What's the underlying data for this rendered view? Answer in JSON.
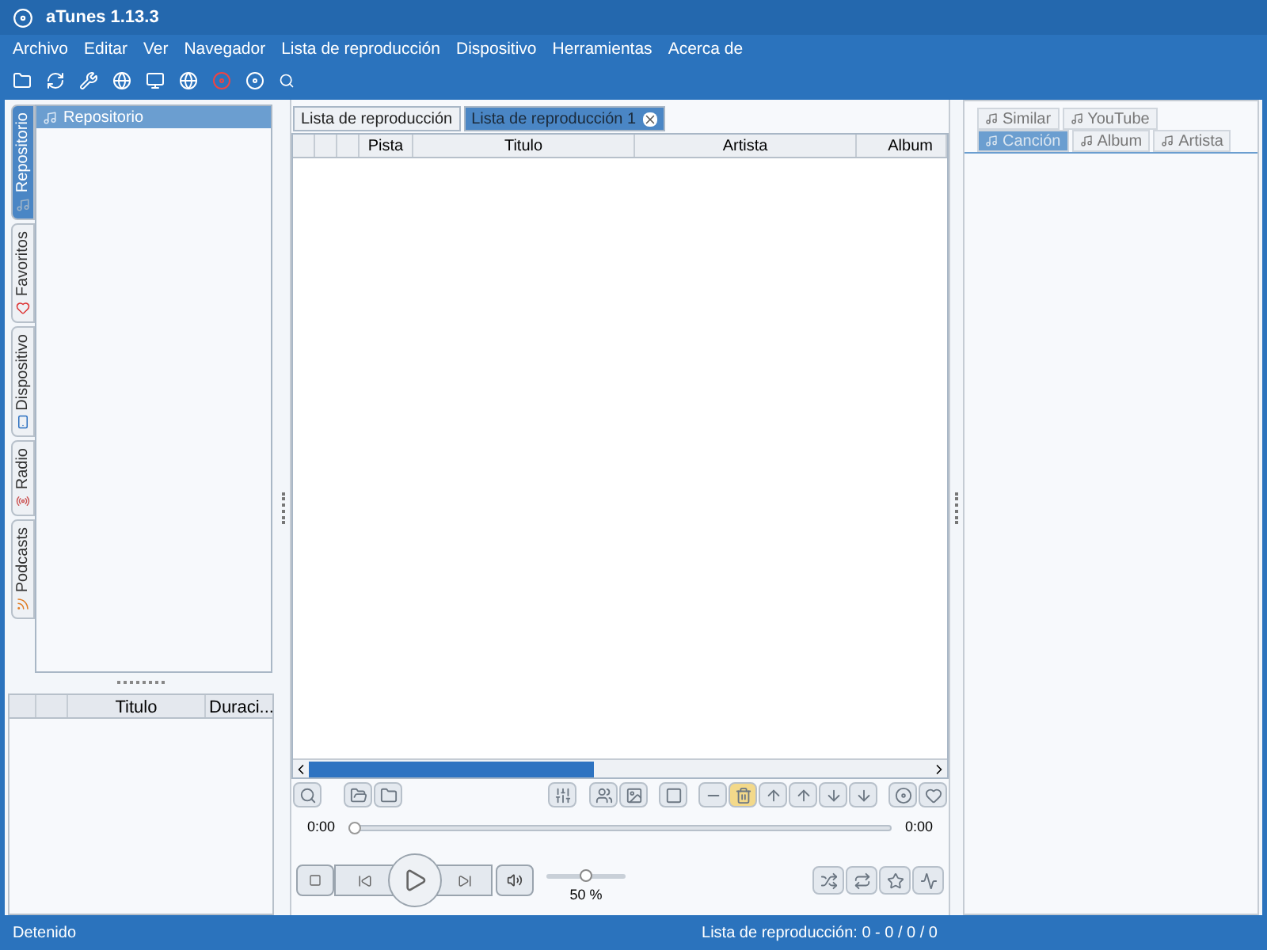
{
  "window": {
    "title": "aTunes 1.13.3"
  },
  "menu": [
    "Archivo",
    "Editar",
    "Ver",
    "Navegador",
    "Lista de reproducción",
    "Dispositivo",
    "Herramientas",
    "Acerca de"
  ],
  "side_tabs": [
    {
      "label": "Repositorio",
      "selected": true
    },
    {
      "label": "Favoritos",
      "selected": false
    },
    {
      "label": "Dispositivo",
      "selected": false
    },
    {
      "label": "Radio",
      "selected": false
    },
    {
      "label": "Podcasts",
      "selected": false
    }
  ],
  "navigator": {
    "title": "Repositorio"
  },
  "song_list": {
    "columns": [
      "Titulo",
      "Duraci..."
    ]
  },
  "playlist_tabs": [
    {
      "label": "Lista de reproducción",
      "selected": false,
      "closable": false
    },
    {
      "label": "Lista de reproducción 1",
      "selected": true,
      "closable": true
    }
  ],
  "playlist": {
    "columns": [
      "Pista",
      "Titulo",
      "Artista",
      "Album"
    ]
  },
  "player": {
    "elapsed": "0:00",
    "total": "0:00",
    "progress": {
      "level": 0
    },
    "volume": {
      "level": 0.5
    },
    "volume_reading": "50 %"
  },
  "context_tabs": [
    [
      {
        "label": "Similar",
        "selected": false
      },
      {
        "label": "YouTube",
        "selected": false
      }
    ],
    [
      {
        "label": "Canción",
        "selected": true
      },
      {
        "label": "Album",
        "selected": false
      },
      {
        "label": "Artista",
        "selected": false
      }
    ]
  ],
  "status_bar": {
    "left": "Detenido",
    "right": "Lista de reproducción: 0 - 0 / 0 / 0"
  }
}
